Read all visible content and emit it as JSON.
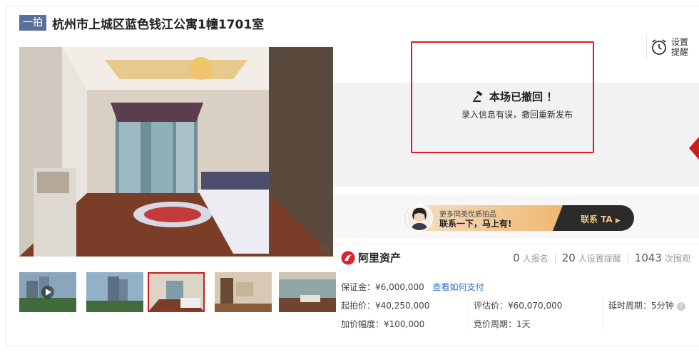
{
  "header": {
    "badge": "一拍",
    "title": "杭州市上城区蓝色钱江公寓1幢1701室"
  },
  "reminder": {
    "label": "设置提醒"
  },
  "status": {
    "title": "本场已撤回 ！",
    "subtitle": "录入信息有误，撤回重新发布"
  },
  "contact": {
    "line1": "更多同类优质拍品",
    "line2": "联系一下，马上有!",
    "button": "联系 TA"
  },
  "brand": {
    "name": "阿里资产"
  },
  "stats": [
    {
      "count": "0",
      "label": "人报名"
    },
    {
      "count": "20",
      "label": "人设置提醒"
    },
    {
      "count": "1043",
      "label": "次围观"
    }
  ],
  "info": {
    "deposit": "保证金：¥6,000,000",
    "pay_link": "查看如何支付",
    "start_price": "起拍价：¥40,250,000",
    "appraisal": "评估价：¥60,070,000",
    "delay": "延时周期：5分钟",
    "increment": "加价幅度：¥100,000",
    "bid_cycle": "竞价周期：1天"
  },
  "colors": {
    "accent": "#c8201e",
    "link": "#2a6cc2",
    "badge": "#5b6f9b"
  }
}
